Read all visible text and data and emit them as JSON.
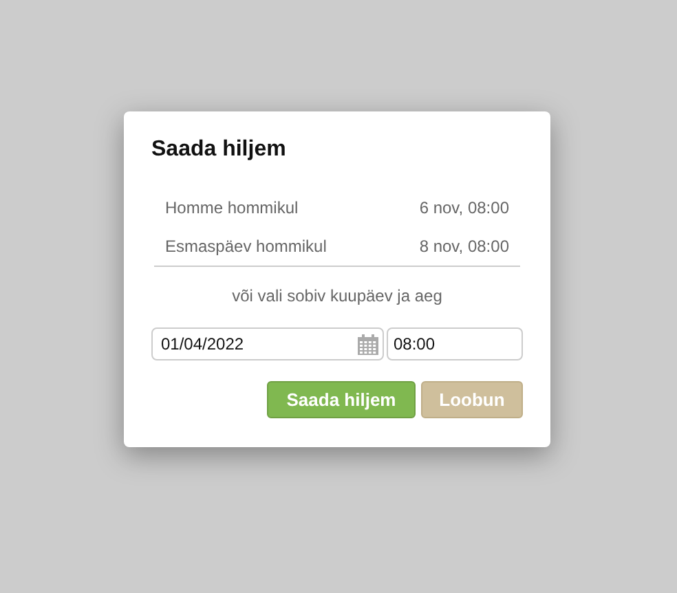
{
  "dialog": {
    "title": "Saada hiljem",
    "options": [
      {
        "label": "Homme hommikul",
        "time": "6 nov, 08:00"
      },
      {
        "label": "Esmaspäev hommikul",
        "time": "8 nov, 08:00"
      }
    ],
    "hint": "või vali sobiv kuupäev ja aeg",
    "date": {
      "value": "01/04/2022"
    },
    "time": {
      "value": "08:00"
    },
    "buttons": [
      {
        "label": "Saada hiljem",
        "kind": "primary"
      },
      {
        "label": "Loobun",
        "kind": "cancel"
      }
    ]
  }
}
